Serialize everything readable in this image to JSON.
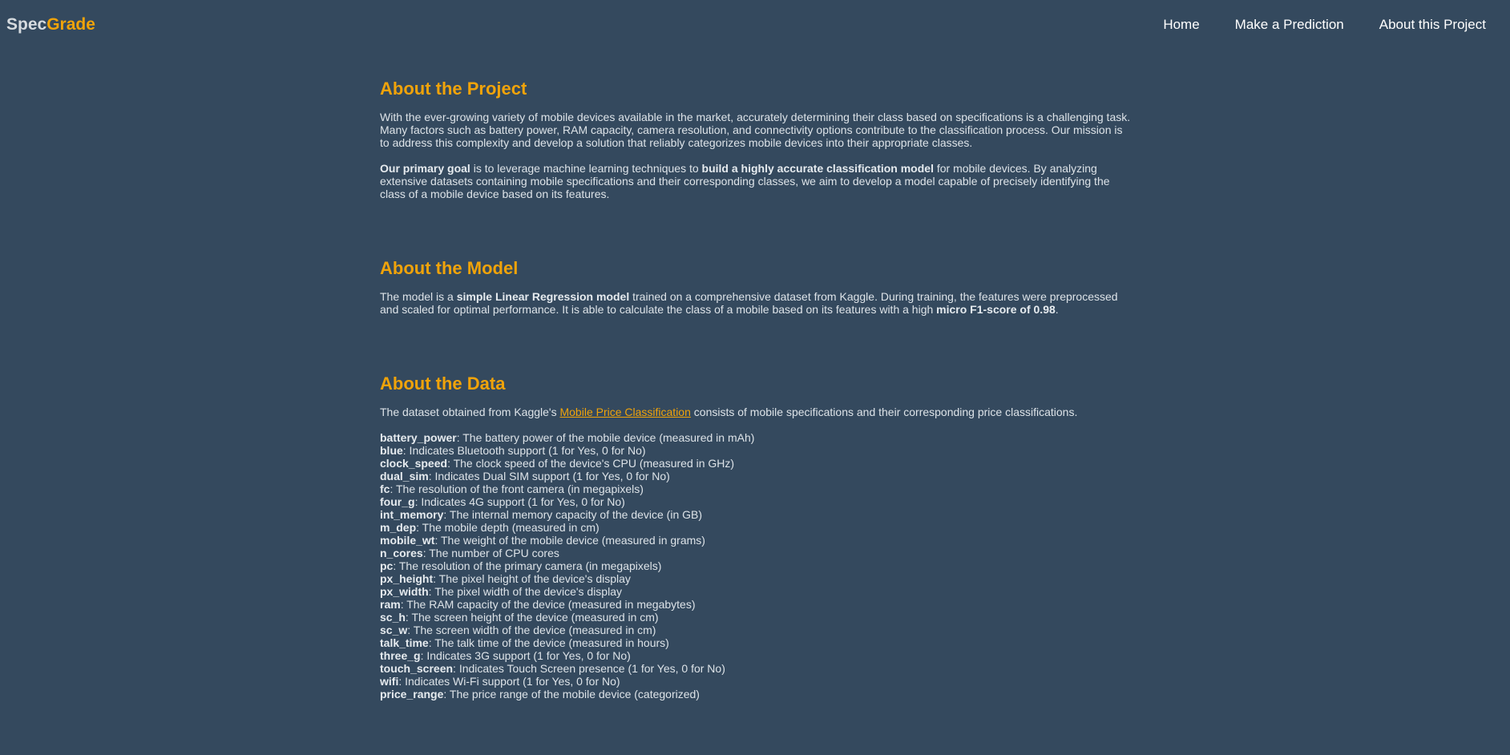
{
  "brand": {
    "part1": "Spec",
    "part2": "Grade"
  },
  "nav": [
    {
      "label": "Home"
    },
    {
      "label": "Make a Prediction"
    },
    {
      "label": "About this Project"
    }
  ],
  "project": {
    "title": "About the Project",
    "p1": "With the ever-growing variety of mobile devices available in the market, accurately determining their class based on specifications is a challenging task. Many factors such as battery power, RAM capacity, camera resolution, and connectivity options contribute to the classification process. Our mission is to address this complexity and develop a solution that reliably categorizes mobile devices into their appropriate classes.",
    "p2_bold1": "Our primary goal",
    "p2_text1": " is to leverage machine learning techniques to ",
    "p2_bold2": "build a highly accurate classification model",
    "p2_text2": " for mobile devices. By analyzing extensive datasets containing mobile specifications and their corresponding classes, we aim to develop a model capable of precisely identifying the class of a mobile device based on its features."
  },
  "model": {
    "title": "About the Model",
    "text1": "The model is a ",
    "bold1": "simple Linear Regression model",
    "text2": " trained on a comprehensive dataset from Kaggle. During training, the features were preprocessed and scaled for optimal performance. It is able to calculate the class of a mobile based on its features with a high ",
    "bold2": "micro F1-score of 0.98",
    "text3": "."
  },
  "data_section": {
    "title": "About the Data",
    "intro1": "The dataset obtained from Kaggle's ",
    "link": "Mobile Price Classification",
    "intro2": " consists of mobile specifications and their corresponding price classifications.",
    "features": [
      {
        "name": "battery_power",
        "desc": ": The battery power of the mobile device (measured in mAh)"
      },
      {
        "name": "blue",
        "desc": ": Indicates Bluetooth support (1 for Yes, 0 for No)"
      },
      {
        "name": "clock_speed",
        "desc": ": The clock speed of the device's CPU (measured in GHz)"
      },
      {
        "name": "dual_sim",
        "desc": ": Indicates Dual SIM support (1 for Yes, 0 for No)"
      },
      {
        "name": "fc",
        "desc": ": The resolution of the front camera (in megapixels)"
      },
      {
        "name": "four_g",
        "desc": ": Indicates 4G support (1 for Yes, 0 for No)"
      },
      {
        "name": "int_memory",
        "desc": ": The internal memory capacity of the device (in GB)"
      },
      {
        "name": "m_dep",
        "desc": ": The mobile depth (measured in cm)"
      },
      {
        "name": "mobile_wt",
        "desc": ": The weight of the mobile device (measured in grams)"
      },
      {
        "name": "n_cores",
        "desc": ": The number of CPU cores"
      },
      {
        "name": "pc",
        "desc": ": The resolution of the primary camera (in megapixels)"
      },
      {
        "name": "px_height",
        "desc": ": The pixel height of the device's display"
      },
      {
        "name": "px_width",
        "desc": ": The pixel width of the device's display"
      },
      {
        "name": "ram",
        "desc": ": The RAM capacity of the device (measured in megabytes)"
      },
      {
        "name": "sc_h",
        "desc": ": The screen height of the device (measured in cm)"
      },
      {
        "name": "sc_w",
        "desc": ": The screen width of the device (measured in cm)"
      },
      {
        "name": "talk_time",
        "desc": ": The talk time of the device (measured in hours)"
      },
      {
        "name": "three_g",
        "desc": ": Indicates 3G support (1 for Yes, 0 for No)"
      },
      {
        "name": "touch_screen",
        "desc": ": Indicates Touch Screen presence (1 for Yes, 0 for No)"
      },
      {
        "name": "wifi",
        "desc": ": Indicates Wi-Fi support (1 for Yes, 0 for No)"
      },
      {
        "name": "price_range",
        "desc": ": The price range of the mobile device (categorized)"
      }
    ]
  },
  "colors": {
    "background": "#34495e",
    "accent": "#f0a30a",
    "text": "#dde3e8"
  }
}
